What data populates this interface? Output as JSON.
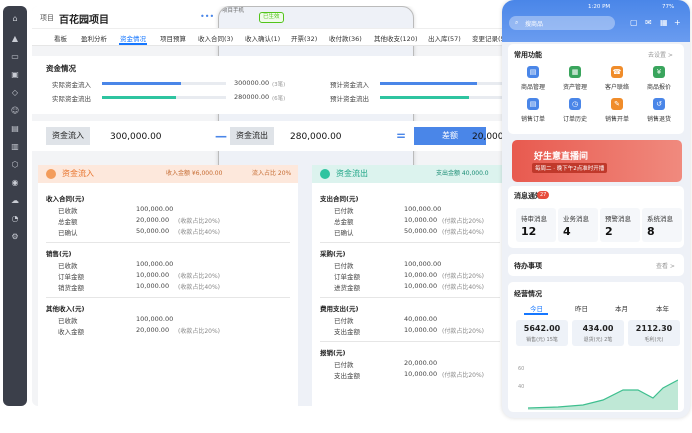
{
  "project": {
    "label": "项目",
    "name": "百花园项目",
    "phone_chip": "项目手机",
    "status_chip": "已生效"
  },
  "tabs": [
    "看板",
    "盈利分析",
    "资金情况",
    "项目预算",
    "收入合同(3)",
    "收入确认(1)",
    "开票(32)",
    "收付款(36)",
    "其他收支(120)",
    "出入库(57)",
    "变更记录(5)"
  ],
  "active_tab": 2,
  "funds": {
    "title": "资金情况",
    "inflow": {
      "label": "实际资金流入",
      "value": "300000.00",
      "count": "(3笔)",
      "ratio": 0.64,
      "color": "#4a86e8"
    },
    "outflow": {
      "label": "实际资金流出",
      "value": "280000.00",
      "count": "(6笔)",
      "ratio": 0.6,
      "color": "#2ec4a0"
    },
    "plan_in": {
      "label": "预计资金流入",
      "ratio": 0.78,
      "color": "#4a86e8"
    },
    "plan_out": {
      "label": "预计资金流出",
      "ratio": 0.72,
      "color": "#2ec4a0"
    }
  },
  "flow": {
    "in_label": "资金流入",
    "in_value": "300,000.00",
    "out_label": "资金流出",
    "out_value": "280,000.00",
    "minus": "—",
    "equals": "=",
    "diff_label": "差额",
    "diff_value": "20,000.0"
  },
  "left_panel": {
    "header": "资金流入",
    "header_stat1": "收入金额 ¥6,000.00",
    "header_stat2": "流入占比 20%",
    "sections": [
      {
        "title": "收入合同(元)",
        "rows": [
          {
            "k": "已收款",
            "v": "100,000.00",
            "note": ""
          },
          {
            "k": "总金额",
            "v": "20,000.00",
            "note": "(收款占比20%)"
          },
          {
            "k": "已确认",
            "v": "50,000.00",
            "note": "(收款占比40%)"
          }
        ]
      },
      {
        "title": "销售(元)",
        "rows": [
          {
            "k": "已收款",
            "v": "100,000.00",
            "note": ""
          },
          {
            "k": "订单金额",
            "v": "10,000.00",
            "note": "(收款占比20%)"
          },
          {
            "k": "销货金额",
            "v": "10,000.00",
            "note": "(收款占比40%)"
          }
        ]
      },
      {
        "title": "其他收入(元)",
        "rows": [
          {
            "k": "已收款",
            "v": "100,000.00",
            "note": ""
          },
          {
            "k": "收入金额",
            "v": "20,000.00",
            "note": "(收款占比20%)"
          }
        ]
      }
    ]
  },
  "right_panel": {
    "header": "资金流出",
    "header_stat1": "支出金额 40,000.0",
    "sections": [
      {
        "title": "支出合同(元)",
        "rows": [
          {
            "k": "已付款",
            "v": "100,000.00",
            "note": ""
          },
          {
            "k": "总金额",
            "v": "10,000.00",
            "note": "(付款占比20%)"
          },
          {
            "k": "已确认",
            "v": "50,000.00",
            "note": "(付款占比40%)"
          }
        ]
      },
      {
        "title": "采购(元)",
        "rows": [
          {
            "k": "已付款",
            "v": "100,000.00",
            "note": ""
          },
          {
            "k": "订单金额",
            "v": "10,000.00",
            "note": "(付款占比20%)"
          },
          {
            "k": "进货金额",
            "v": "10,000.00",
            "note": "(付款占比40%)"
          }
        ]
      },
      {
        "title": "费用支出(元)",
        "rows": [
          {
            "k": "已付款",
            "v": "40,000.00",
            "note": ""
          },
          {
            "k": "支出金额",
            "v": "10,000.00",
            "note": "(付款占比20%)"
          }
        ]
      },
      {
        "title": "报销(元)",
        "rows": [
          {
            "k": "已付款",
            "v": "20,000.00",
            "note": ""
          },
          {
            "k": "支出金额",
            "v": "10,000.00",
            "note": "(付款占比20%)"
          }
        ]
      }
    ]
  },
  "phone": {
    "time": "1:20 PM",
    "battery": "77%",
    "search_placeholder": "搜商品",
    "common": {
      "title": "常用功能",
      "link": "去设置 >"
    },
    "tiles": [
      {
        "label": "商品管理",
        "color": "#4a86e8",
        "glyph": "▤"
      },
      {
        "label": "资产管理",
        "color": "#3aa55d",
        "glyph": "▦"
      },
      {
        "label": "客户联络",
        "color": "#f08c2a",
        "glyph": "☎"
      },
      {
        "label": "商品报价",
        "color": "#3aa55d",
        "glyph": "¥"
      },
      {
        "label": "销售订单",
        "color": "#4a86e8",
        "glyph": "▤"
      },
      {
        "label": "订单历史",
        "color": "#4a86e8",
        "glyph": "◷"
      },
      {
        "label": "销售开单",
        "color": "#f08c2a",
        "glyph": "✎"
      },
      {
        "label": "销售退货",
        "color": "#4a86e8",
        "glyph": "↺"
      }
    ],
    "banner": {
      "title": "好生意直播间",
      "sub": "每周二 · 晚下午2点准时开播"
    },
    "messages": {
      "title": "消息通知",
      "badge": "27",
      "items": [
        {
          "label": "待审消息",
          "n": "12"
        },
        {
          "label": "业务消息",
          "n": "4"
        },
        {
          "label": "预警消息",
          "n": "2"
        },
        {
          "label": "系统消息",
          "n": "8"
        }
      ]
    },
    "todo": {
      "title": "待办事项",
      "link": "查看 >"
    },
    "business": {
      "title": "经营情况",
      "tabs": [
        "今日",
        "昨日",
        "本月",
        "本年"
      ],
      "stats": [
        {
          "v": "5642.00",
          "s": "销售(元) 15笔"
        },
        {
          "v": "434.00",
          "s": "退货(元) 2笔"
        },
        {
          "v": "2112.30",
          "s": "毛利(元)"
        }
      ],
      "y_ticks": [
        "60",
        "40"
      ]
    }
  }
}
